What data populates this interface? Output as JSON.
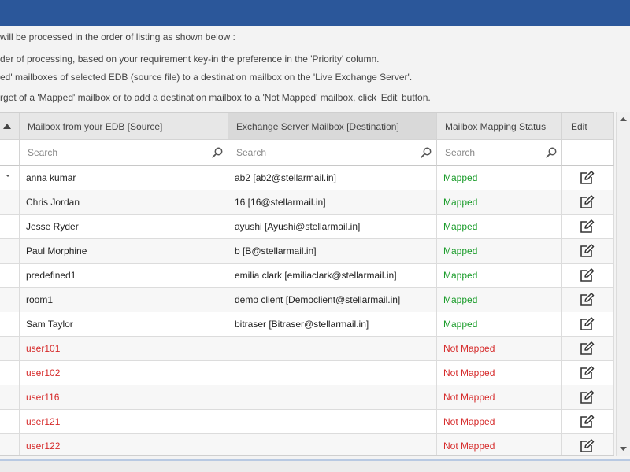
{
  "info_lines": [
    "will be processed in the order of listing as shown below :",
    "der of processing, based on your requirement key-in the preference in the 'Priority' column.",
    "ed' mailboxes of selected EDB (source file) to a destination mailbox on the 'Live Exchange Server'.",
    "rget of a 'Mapped' mailbox or to add a destination mailbox to a 'Not Mapped' mailbox, click 'Edit' button."
  ],
  "columns": {
    "source": "Mailbox from your EDB [Source]",
    "destination": "Exchange Server Mailbox [Destination]",
    "status": "Mailbox Mapping Status",
    "edit": "Edit"
  },
  "search": {
    "source_placeholder": "Search",
    "destination_placeholder": "Search",
    "status_placeholder": "Search"
  },
  "rows": [
    {
      "source": "anna kumar",
      "destination": "ab2 [ab2@stellarmail.in]",
      "status": "Mapped",
      "mapped": true
    },
    {
      "source": "Chris Jordan",
      "destination": "16 [16@stellarmail.in]",
      "status": "Mapped",
      "mapped": true
    },
    {
      "source": "Jesse Ryder",
      "destination": "ayushi [Ayushi@stellarmail.in]",
      "status": "Mapped",
      "mapped": true
    },
    {
      "source": "Paul Morphine",
      "destination": "b [B@stellarmail.in]",
      "status": "Mapped",
      "mapped": true
    },
    {
      "source": "predefined1",
      "destination": "emilia clark [emiliaclark@stellarmail.in]",
      "status": "Mapped",
      "mapped": true
    },
    {
      "source": "room1",
      "destination": "demo client [Democlient@stellarmail.in]",
      "status": "Mapped",
      "mapped": true
    },
    {
      "source": "Sam Taylor",
      "destination": "bitraser [Bitraser@stellarmail.in]",
      "status": "Mapped",
      "mapped": true
    },
    {
      "source": "user101",
      "destination": "",
      "status": "Not Mapped",
      "mapped": false
    },
    {
      "source": "user102",
      "destination": "",
      "status": "Not Mapped",
      "mapped": false
    },
    {
      "source": "user116",
      "destination": "",
      "status": "Not Mapped",
      "mapped": false
    },
    {
      "source": "user121",
      "destination": "",
      "status": "Not Mapped",
      "mapped": false
    },
    {
      "source": "user122",
      "destination": "",
      "status": "Not Mapped",
      "mapped": false
    }
  ],
  "colors": {
    "titlebar": "#2b579a",
    "mapped": "#1a9c2a",
    "not_mapped": "#d62a2a"
  },
  "icons": {
    "sort": "sort-ascending-icon",
    "search": "magnifier-icon",
    "edit": "edit-pencil-icon",
    "scroll_up": "arrow-up-icon",
    "scroll_down": "arrow-down-icon"
  }
}
